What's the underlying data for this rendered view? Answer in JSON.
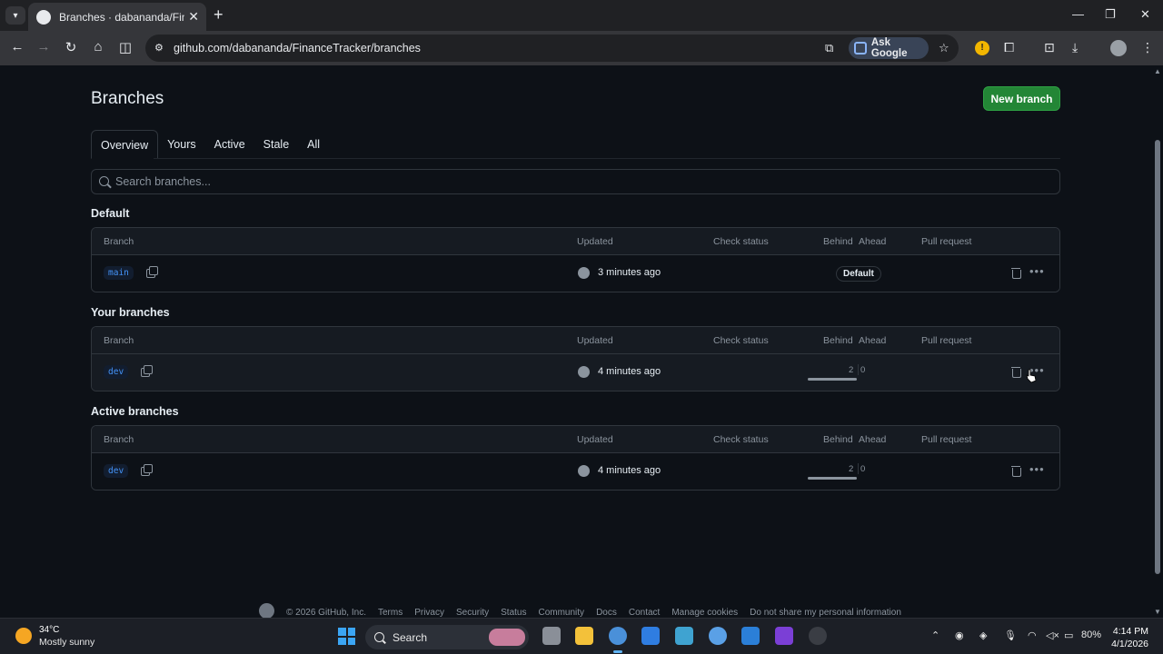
{
  "browser": {
    "tab_title": "Branches · dabananda/FinanceTracker",
    "url": "github.com/dabananda/FinanceTracker/branches",
    "ask_google": "Ask Google"
  },
  "page": {
    "title": "Branches",
    "new_branch_label": "New branch",
    "tabs": [
      "Overview",
      "Yours",
      "Active",
      "Stale",
      "All"
    ],
    "selected_tab": "Overview",
    "search_placeholder": "Search branches...",
    "columns": {
      "branch": "Branch",
      "updated": "Updated",
      "check_status": "Check status",
      "behind": "Behind",
      "ahead": "Ahead",
      "pull_request": "Pull request"
    },
    "sections": [
      {
        "title": "Default",
        "rows": [
          {
            "branch": "main",
            "updated": "3 minutes ago",
            "badge": "Default",
            "behind": null,
            "ahead": null
          }
        ]
      },
      {
        "title": "Your branches",
        "rows": [
          {
            "branch": "dev",
            "updated": "4 minutes ago",
            "badge": null,
            "behind": "2",
            "ahead": "0"
          }
        ]
      },
      {
        "title": "Active branches",
        "rows": [
          {
            "branch": "dev",
            "updated": "4 minutes ago",
            "badge": null,
            "behind": "2",
            "ahead": "0"
          }
        ]
      }
    ],
    "footer_links": [
      "© 2026 GitHub, Inc.",
      "Terms",
      "Privacy",
      "Security",
      "Status",
      "Community",
      "Docs",
      "Contact",
      "Manage cookies",
      "Do not share my personal information"
    ]
  },
  "taskbar": {
    "weather_temp": "34°C",
    "weather_desc": "Mostly sunny",
    "search_label": "Search",
    "battery": "80%",
    "time": "4:14 PM",
    "date": "4/1/2026"
  },
  "colors": {
    "accent_green": "#238636",
    "link_blue": "#4493f8",
    "page_bg": "#0d1117"
  }
}
